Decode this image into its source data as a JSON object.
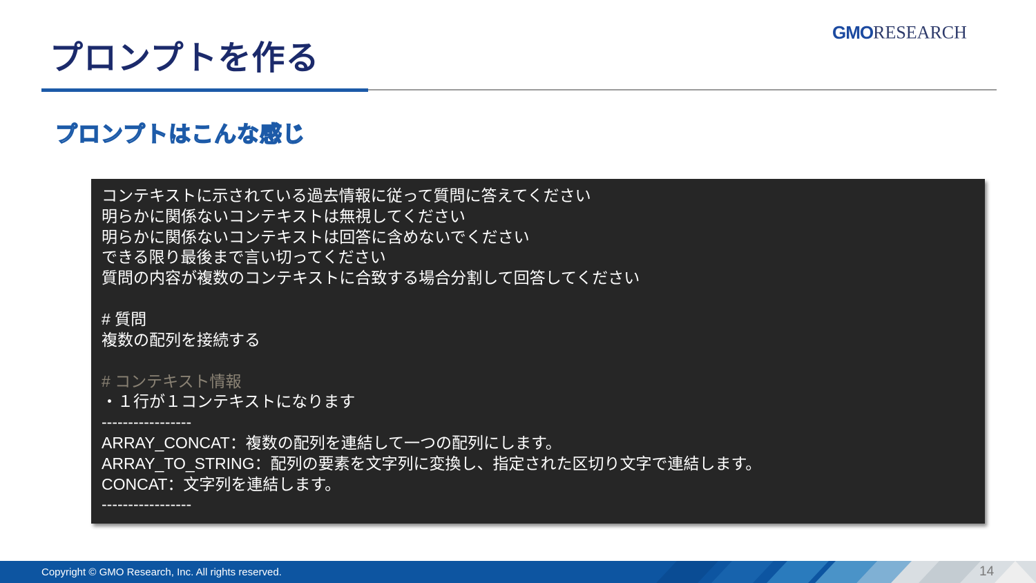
{
  "slide": {
    "title": "プロンプトを作る",
    "subtitle": "プロンプトはこんな感じ"
  },
  "logo": {
    "gmo": "GMO",
    "research": "RESEARCH"
  },
  "prompt": {
    "lines": [
      "コンテキストに示されている過去情報に従って質問に答えてください",
      "明らかに関係ないコンテキストは無視してください",
      "明らかに関係ないコンテキストは回答に含めないでください",
      "できる限り最後まで言い切ってください",
      "質問の内容が複数のコンテキストに合致する場合分割して回答してください",
      "",
      "# 質問",
      "複数の配列を接続する",
      "",
      "# コンテキスト情報",
      "・１行が１コンテキストになります",
      "-----------------",
      "ARRAY_CONCAT：複数の配列を連結して一つの配列にします。",
      "ARRAY_TO_STRING：配列の要素を文字列に変換し、指定された区切り文字で連結します。",
      "CONCAT：文字列を連結します。",
      "-----------------"
    ]
  },
  "footer": {
    "copyright": "Copyright © GMO Research, Inc. All rights reserved.",
    "page_number": "14"
  },
  "colors": {
    "title": "#1b2a6b",
    "accent_blue": "#1c5aa8",
    "prompt_bg": "#262626",
    "muted_text": "#8a8274",
    "footer_bg": "#0d55a1"
  }
}
